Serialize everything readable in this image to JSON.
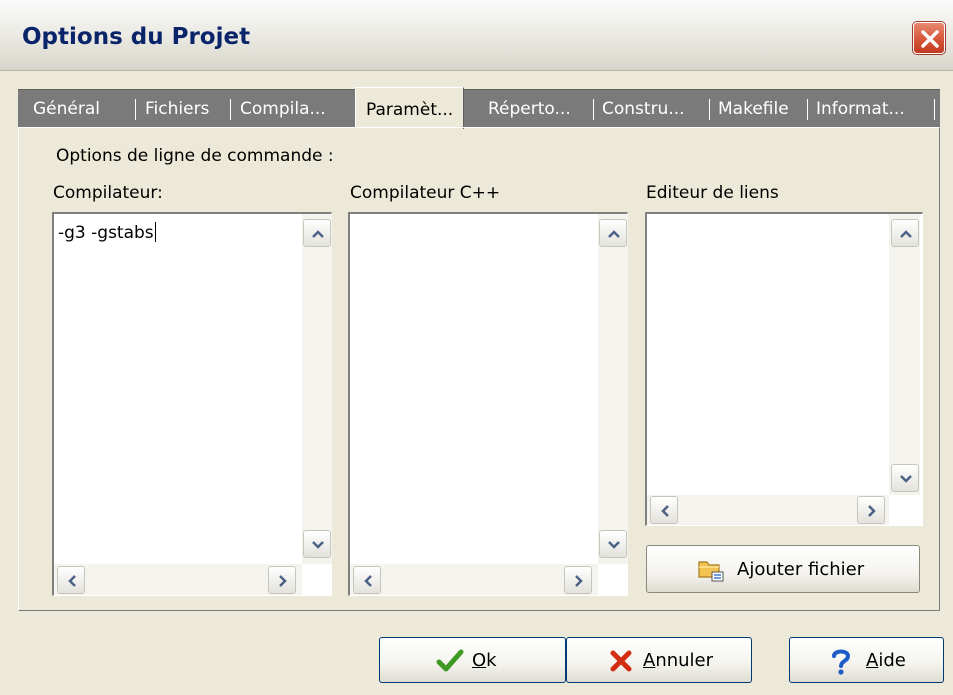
{
  "window": {
    "title": "Options du Projet"
  },
  "tabs": [
    {
      "label": "Général",
      "active": false
    },
    {
      "label": "Fichiers",
      "active": false
    },
    {
      "label": "Compila...",
      "active": false
    },
    {
      "label": "Paramèt...",
      "active": true
    },
    {
      "label": "Réperto...",
      "active": false
    },
    {
      "label": "Constru...",
      "active": false
    },
    {
      "label": "Makefile",
      "active": false
    },
    {
      "label": "Informat...",
      "active": false
    }
  ],
  "params": {
    "section_label": "Options de ligne de commande :",
    "compiler": {
      "label": "Compilateur:",
      "value": "-g3 -gstabs"
    },
    "cpp_compiler": {
      "label": "Compilateur C++",
      "value": ""
    },
    "linker": {
      "label": "Editeur de liens",
      "value": ""
    },
    "add_file_label": "Ajouter fichier"
  },
  "buttons": {
    "ok_mnemonic": "O",
    "ok_rest": "k",
    "cancel_mnemonic": "A",
    "cancel_rest": "nnuler",
    "help_mnemonic": "A",
    "help_rest": "ide"
  },
  "icons": {
    "close": "close-icon",
    "ok": "checkmark-icon",
    "cancel": "red-x-icon",
    "help": "question-mark-icon",
    "add_file": "folder-icon"
  },
  "colors": {
    "dialog_bg": "#ece9d8",
    "title_text": "#0a246a",
    "tab_strip": "#7a7a7a",
    "close_button": "#d85a3d",
    "ok_check": "#3f9a23",
    "cancel_x": "#d42e12",
    "help_question": "#1e5cc8"
  }
}
